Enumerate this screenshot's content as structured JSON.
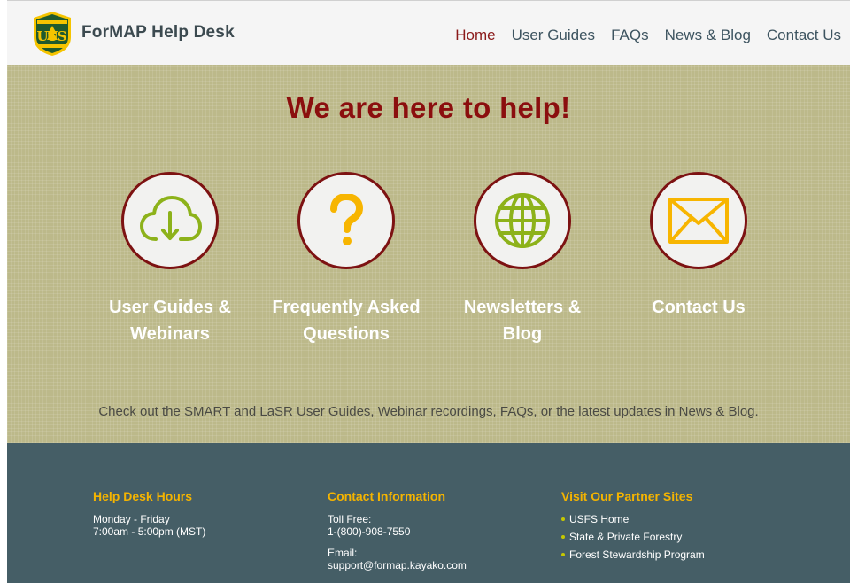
{
  "header": {
    "brand": "ForMAP Help Desk",
    "logo_icon": "usfs-shield-icon",
    "nav": [
      {
        "label": "Home",
        "active": true
      },
      {
        "label": "User Guides",
        "active": false
      },
      {
        "label": "FAQs",
        "active": false
      },
      {
        "label": "News & Blog",
        "active": false
      },
      {
        "label": "Contact Us",
        "active": false
      }
    ]
  },
  "hero": {
    "title": "We are here to help!",
    "features": [
      {
        "icon": "cloud-download-icon",
        "label_line1": "User Guides &",
        "label_line2": "Webinars"
      },
      {
        "icon": "question-mark-icon",
        "label_line1": "Frequently Asked",
        "label_line2": "Questions"
      },
      {
        "icon": "globe-icon",
        "label_line1": "Newsletters &",
        "label_line2": "Blog"
      },
      {
        "icon": "envelope-icon",
        "label_line1": "Contact Us",
        "label_line2": ""
      }
    ],
    "caption": "Check out the SMART and LaSR User Guides, Webinar recordings, FAQs, or the latest updates in News & Blog."
  },
  "footer": {
    "hours": {
      "heading": "Help Desk Hours",
      "days": "Monday - Friday",
      "time": "7:00am - 5:00pm (MST)"
    },
    "contact": {
      "heading": "Contact Information",
      "phone_label": "Toll Free:",
      "phone": "1-(800)-908-7550",
      "email_label": "Email:",
      "email": "support@formap.kayako.com"
    },
    "partners": {
      "heading": "Visit Our Partner Sites",
      "links": [
        "USFS Home",
        "State & Private Forestry",
        "Forest Stewardship Program"
      ]
    }
  },
  "colors": {
    "nav_active": "#8b1a1a",
    "nav_link": "#3d5460",
    "hero_bg": "#bcb98a",
    "hero_title": "#8b0e0e",
    "circle_border": "#7d1212",
    "icon_green": "#8db21a",
    "icon_orange": "#f7b500",
    "footer_bg": "#455e66",
    "footer_heading": "#f5b400"
  }
}
